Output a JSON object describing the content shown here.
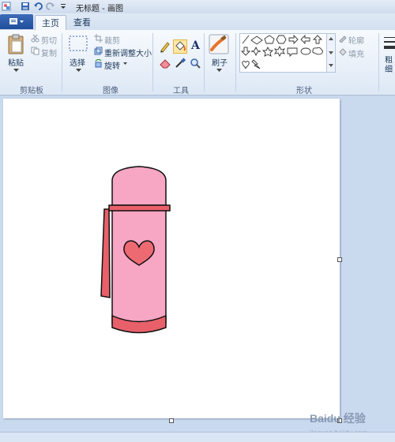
{
  "window": {
    "title": "无标题 - 画图",
    "quick_access_icons": [
      "save-icon",
      "undo-icon",
      "redo-icon",
      "customize-dropdown-icon"
    ]
  },
  "tabs": {
    "file_menu_icon": "file-menu-icon",
    "home": "主页",
    "view": "查看"
  },
  "ribbon": {
    "clipboard": {
      "group_label": "剪贴板",
      "paste": "粘贴",
      "cut": "剪切",
      "copy": "复制"
    },
    "image": {
      "group_label": "图像",
      "select": "选择",
      "crop": "裁剪",
      "resize": "重新调整大小",
      "rotate": "旋转"
    },
    "tools": {
      "group_label": "工具",
      "items": [
        "pencil-icon",
        "fill-icon",
        "text-icon",
        "eraser-icon",
        "color-picker-icon",
        "magnifier-icon"
      ],
      "active": "fill-icon",
      "text_glyph": "A"
    },
    "brushes": {
      "label": "刷子"
    },
    "shapes": {
      "group_label": "形状",
      "outline": "轮廓",
      "fill": "填充",
      "items": [
        "line",
        "curve",
        "oval",
        "rectangle",
        "rounded-rectangle",
        "polygon",
        "triangle",
        "right-triangle",
        "diamond",
        "pentagon",
        "hexagon",
        "right-arrow",
        "left-arrow",
        "up-arrow",
        "down-arrow",
        "four-point-star",
        "five-point-star",
        "six-point-star",
        "rounded-callout",
        "oval-callout",
        "cloud-callout",
        "heart",
        "lightning"
      ]
    },
    "size": {
      "label": "粗细"
    }
  },
  "canvas": {
    "drawing": "thermos-with-heart",
    "colors": {
      "body": "#f7a6c3",
      "accent": "#e8606a",
      "heart": "#ee6a73",
      "outline": "#111111"
    }
  },
  "watermark": {
    "brand": "Baidu 经验",
    "url": "jingyan.baidu.com"
  }
}
